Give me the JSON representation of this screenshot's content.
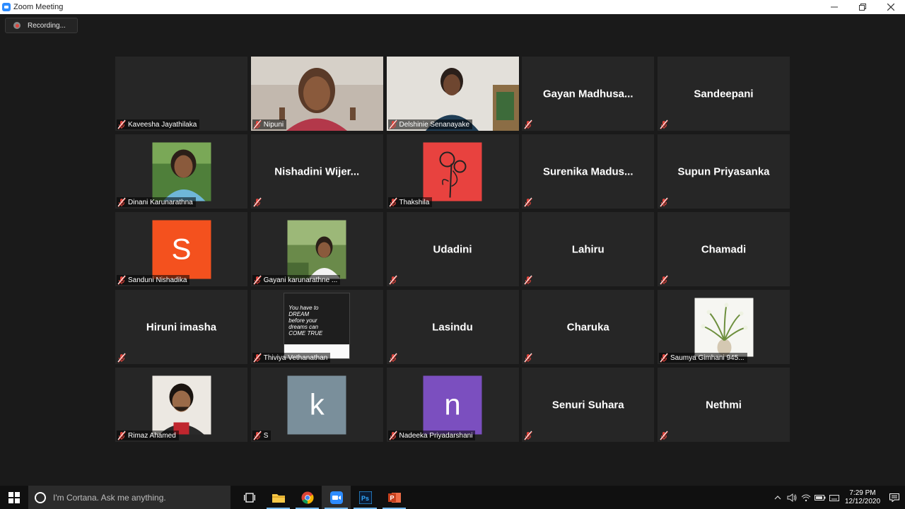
{
  "window": {
    "title": "Zoom Meeting"
  },
  "recording": {
    "label": "Recording..."
  },
  "participants": [
    {
      "name": "Kaveesha Jayathilaka",
      "show_label": true
    },
    {
      "name": "Nipuni",
      "show_label": true
    },
    {
      "name": "Delshinie Senanayake",
      "show_label": true
    },
    {
      "name": "Gayan Madhusa...",
      "show_label": false
    },
    {
      "name": "Sandeepani",
      "show_label": false
    },
    {
      "name": "Dinani Karunarathna",
      "show_label": true
    },
    {
      "name": "Nishadini Wijer...",
      "show_label": false
    },
    {
      "name": "Thakshila",
      "show_label": true
    },
    {
      "name": "Surenika Madus...",
      "show_label": false
    },
    {
      "name": "Supun Priyasanka",
      "show_label": false
    },
    {
      "name": "Sanduni Nishadika",
      "show_label": true,
      "letter": "S",
      "avatar_color": "#f4511e"
    },
    {
      "name": "Gayani karunarathne ...",
      "show_label": true
    },
    {
      "name": "Udadini",
      "show_label": false
    },
    {
      "name": "Lahiru",
      "show_label": false
    },
    {
      "name": "Chamadi",
      "show_label": false
    },
    {
      "name": "Hiruni imasha",
      "show_label": false
    },
    {
      "name": "Thiviya Vethanathan",
      "show_label": true,
      "quote": "You have to DREAM before your dreams can COME TRUE"
    },
    {
      "name": "Lasindu",
      "show_label": false
    },
    {
      "name": "Charuka",
      "show_label": false
    },
    {
      "name": "Saumya Gimhani 945...",
      "show_label": true
    },
    {
      "name": "Rimaz Ahamed",
      "show_label": true
    },
    {
      "name": "S",
      "show_label": true,
      "letter": "k",
      "avatar_color": "#7a8f9b"
    },
    {
      "name": "Nadeeka Priyadarshani",
      "show_label": true,
      "letter": "n",
      "avatar_color": "#7b4fbf"
    },
    {
      "name": "Senuri Suhara",
      "show_label": false
    },
    {
      "name": "Nethmi",
      "show_label": false
    }
  ],
  "taskbar": {
    "search_placeholder": "I'm Cortana. Ask me anything.",
    "apps": [
      "task-view",
      "file-explorer",
      "chrome",
      "zoom",
      "photoshop",
      "powerpoint"
    ],
    "time": "7:29 PM",
    "date": "12/12/2020"
  },
  "colors": {
    "tile_bg": "#262626",
    "page_bg": "#1a1a1a",
    "mute_red": "#e0443c"
  }
}
